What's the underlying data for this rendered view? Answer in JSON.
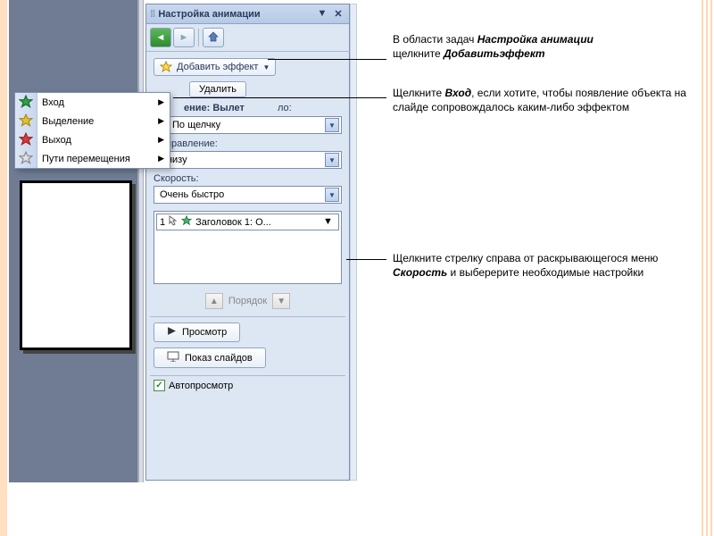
{
  "panel": {
    "title": "Настройка анимации",
    "add_effect": "Добавить эффект",
    "remove": "Удалить",
    "change_label": "ение: Вылет",
    "start_label": "ло:",
    "start_value": "По щелчку",
    "direction_label": "Направление:",
    "direction_value": "Снизу",
    "speed_label": "Скорость:",
    "speed_value": "Очень быстро",
    "effect_item_num": "1",
    "effect_item_text": "Заголовок 1: О...",
    "order_label": "Порядок",
    "preview": "Просмотр",
    "slideshow": "Показ слайдов",
    "autopreview": "Автопросмотр"
  },
  "submenu": {
    "items": [
      {
        "label": "Вход",
        "color": "#2fa04a"
      },
      {
        "label": "Выделение",
        "color": "#e6c22e"
      },
      {
        "label": "Выход",
        "color": "#d93a3a"
      },
      {
        "label": "Пути перемещения",
        "color": "#9aa0b0"
      }
    ]
  },
  "callouts": {
    "c1a": "В области задач ",
    "c1b": "Настройка анимации",
    "c1c": "щелкните ",
    "c1d": "Добавитьэффект",
    "c2a": "Щелкните ",
    "c2b": "Вход",
    "c2c": ", если хотите, чтобы появление объекта на слайде сопровождалось каким-либо эффектом",
    "c3a": "Щелкните стрелку справа от раскрывающегося меню ",
    "c3b": "Скорость",
    "c3c": " и выберерите необходимые настройки"
  }
}
